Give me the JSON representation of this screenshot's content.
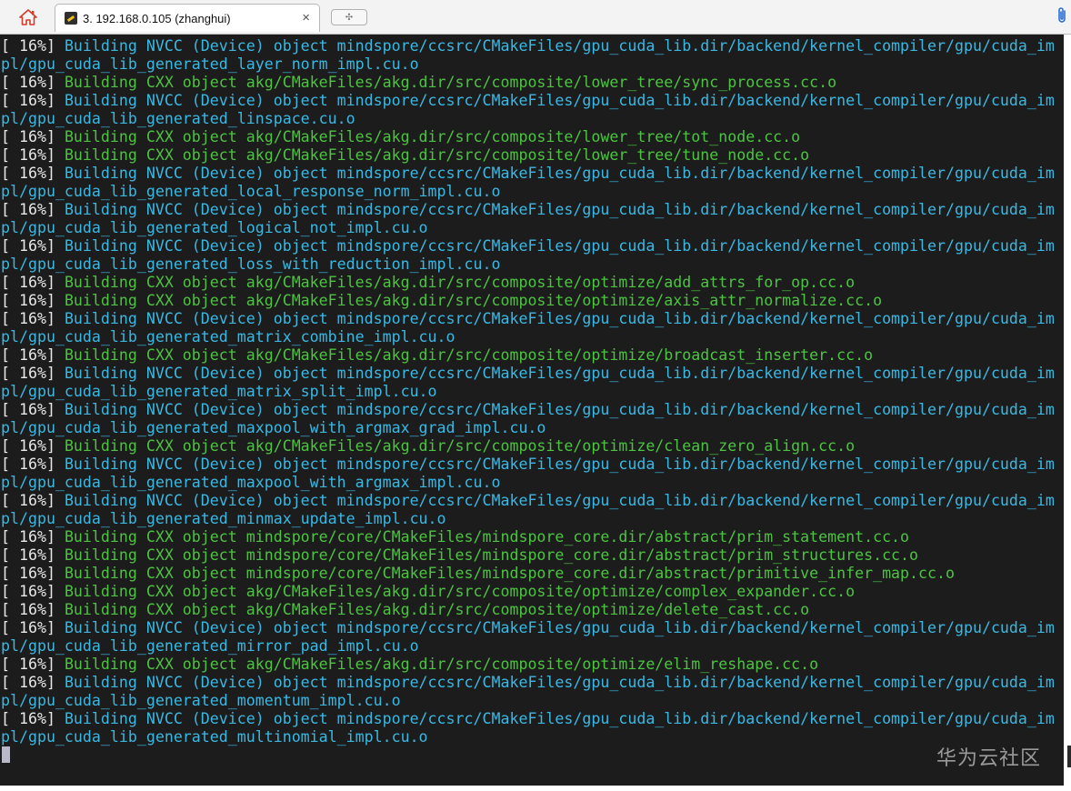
{
  "tabbar": {
    "home_icon": "home-icon",
    "tab_title": "3. 192.168.0.105 (zhanghui)",
    "tab_close": "×",
    "new_tab_glyph": "✣",
    "attach_icon": "paperclip-icon"
  },
  "terminal": {
    "lines": [
      {
        "pct": "[ 16%] ",
        "kind": "nvcc",
        "text": "Building NVCC (Device) object mindspore/ccsrc/CMakeFiles/gpu_cuda_lib.dir/backend/kernel_compiler/gpu/cuda_im"
      },
      {
        "pct": "",
        "kind": "nvcc",
        "text": "pl/gpu_cuda_lib_generated_layer_norm_impl.cu.o"
      },
      {
        "pct": "[ 16%] ",
        "kind": "cxx",
        "text": "Building CXX object akg/CMakeFiles/akg.dir/src/composite/lower_tree/sync_process.cc.o"
      },
      {
        "pct": "[ 16%] ",
        "kind": "nvcc",
        "text": "Building NVCC (Device) object mindspore/ccsrc/CMakeFiles/gpu_cuda_lib.dir/backend/kernel_compiler/gpu/cuda_im"
      },
      {
        "pct": "",
        "kind": "nvcc",
        "text": "pl/gpu_cuda_lib_generated_linspace.cu.o"
      },
      {
        "pct": "[ 16%] ",
        "kind": "cxx",
        "text": "Building CXX object akg/CMakeFiles/akg.dir/src/composite/lower_tree/tot_node.cc.o"
      },
      {
        "pct": "[ 16%] ",
        "kind": "cxx",
        "text": "Building CXX object akg/CMakeFiles/akg.dir/src/composite/lower_tree/tune_node.cc.o"
      },
      {
        "pct": "[ 16%] ",
        "kind": "nvcc",
        "text": "Building NVCC (Device) object mindspore/ccsrc/CMakeFiles/gpu_cuda_lib.dir/backend/kernel_compiler/gpu/cuda_im"
      },
      {
        "pct": "",
        "kind": "nvcc",
        "text": "pl/gpu_cuda_lib_generated_local_response_norm_impl.cu.o"
      },
      {
        "pct": "[ 16%] ",
        "kind": "nvcc",
        "text": "Building NVCC (Device) object mindspore/ccsrc/CMakeFiles/gpu_cuda_lib.dir/backend/kernel_compiler/gpu/cuda_im"
      },
      {
        "pct": "",
        "kind": "nvcc",
        "text": "pl/gpu_cuda_lib_generated_logical_not_impl.cu.o"
      },
      {
        "pct": "[ 16%] ",
        "kind": "nvcc",
        "text": "Building NVCC (Device) object mindspore/ccsrc/CMakeFiles/gpu_cuda_lib.dir/backend/kernel_compiler/gpu/cuda_im"
      },
      {
        "pct": "",
        "kind": "nvcc",
        "text": "pl/gpu_cuda_lib_generated_loss_with_reduction_impl.cu.o"
      },
      {
        "pct": "[ 16%] ",
        "kind": "cxx",
        "text": "Building CXX object akg/CMakeFiles/akg.dir/src/composite/optimize/add_attrs_for_op.cc.o"
      },
      {
        "pct": "[ 16%] ",
        "kind": "cxx",
        "text": "Building CXX object akg/CMakeFiles/akg.dir/src/composite/optimize/axis_attr_normalize.cc.o"
      },
      {
        "pct": "[ 16%] ",
        "kind": "nvcc",
        "text": "Building NVCC (Device) object mindspore/ccsrc/CMakeFiles/gpu_cuda_lib.dir/backend/kernel_compiler/gpu/cuda_im"
      },
      {
        "pct": "",
        "kind": "nvcc",
        "text": "pl/gpu_cuda_lib_generated_matrix_combine_impl.cu.o"
      },
      {
        "pct": "[ 16%] ",
        "kind": "cxx",
        "text": "Building CXX object akg/CMakeFiles/akg.dir/src/composite/optimize/broadcast_inserter.cc.o"
      },
      {
        "pct": "[ 16%] ",
        "kind": "nvcc",
        "text": "Building NVCC (Device) object mindspore/ccsrc/CMakeFiles/gpu_cuda_lib.dir/backend/kernel_compiler/gpu/cuda_im"
      },
      {
        "pct": "",
        "kind": "nvcc",
        "text": "pl/gpu_cuda_lib_generated_matrix_split_impl.cu.o"
      },
      {
        "pct": "[ 16%] ",
        "kind": "nvcc",
        "text": "Building NVCC (Device) object mindspore/ccsrc/CMakeFiles/gpu_cuda_lib.dir/backend/kernel_compiler/gpu/cuda_im"
      },
      {
        "pct": "",
        "kind": "nvcc",
        "text": "pl/gpu_cuda_lib_generated_maxpool_with_argmax_grad_impl.cu.o"
      },
      {
        "pct": "[ 16%] ",
        "kind": "cxx",
        "text": "Building CXX object akg/CMakeFiles/akg.dir/src/composite/optimize/clean_zero_align.cc.o"
      },
      {
        "pct": "[ 16%] ",
        "kind": "nvcc",
        "text": "Building NVCC (Device) object mindspore/ccsrc/CMakeFiles/gpu_cuda_lib.dir/backend/kernel_compiler/gpu/cuda_im"
      },
      {
        "pct": "",
        "kind": "nvcc",
        "text": "pl/gpu_cuda_lib_generated_maxpool_with_argmax_impl.cu.o"
      },
      {
        "pct": "[ 16%] ",
        "kind": "nvcc",
        "text": "Building NVCC (Device) object mindspore/ccsrc/CMakeFiles/gpu_cuda_lib.dir/backend/kernel_compiler/gpu/cuda_im"
      },
      {
        "pct": "",
        "kind": "nvcc",
        "text": "pl/gpu_cuda_lib_generated_minmax_update_impl.cu.o"
      },
      {
        "pct": "[ 16%] ",
        "kind": "cxx",
        "text": "Building CXX object mindspore/core/CMakeFiles/mindspore_core.dir/abstract/prim_statement.cc.o"
      },
      {
        "pct": "[ 16%] ",
        "kind": "cxx",
        "text": "Building CXX object mindspore/core/CMakeFiles/mindspore_core.dir/abstract/prim_structures.cc.o"
      },
      {
        "pct": "[ 16%] ",
        "kind": "cxx",
        "text": "Building CXX object mindspore/core/CMakeFiles/mindspore_core.dir/abstract/primitive_infer_map.cc.o"
      },
      {
        "pct": "[ 16%] ",
        "kind": "cxx",
        "text": "Building CXX object akg/CMakeFiles/akg.dir/src/composite/optimize/complex_expander.cc.o"
      },
      {
        "pct": "[ 16%] ",
        "kind": "cxx",
        "text": "Building CXX object akg/CMakeFiles/akg.dir/src/composite/optimize/delete_cast.cc.o"
      },
      {
        "pct": "[ 16%] ",
        "kind": "nvcc",
        "text": "Building NVCC (Device) object mindspore/ccsrc/CMakeFiles/gpu_cuda_lib.dir/backend/kernel_compiler/gpu/cuda_im"
      },
      {
        "pct": "",
        "kind": "nvcc",
        "text": "pl/gpu_cuda_lib_generated_mirror_pad_impl.cu.o"
      },
      {
        "pct": "[ 16%] ",
        "kind": "cxx",
        "text": "Building CXX object akg/CMakeFiles/akg.dir/src/composite/optimize/elim_reshape.cc.o"
      },
      {
        "pct": "[ 16%] ",
        "kind": "nvcc",
        "text": "Building NVCC (Device) object mindspore/ccsrc/CMakeFiles/gpu_cuda_lib.dir/backend/kernel_compiler/gpu/cuda_im"
      },
      {
        "pct": "",
        "kind": "nvcc",
        "text": "pl/gpu_cuda_lib_generated_momentum_impl.cu.o"
      },
      {
        "pct": "[ 16%] ",
        "kind": "nvcc",
        "text": "Building NVCC (Device) object mindspore/ccsrc/CMakeFiles/gpu_cuda_lib.dir/backend/kernel_compiler/gpu/cuda_im"
      },
      {
        "pct": "",
        "kind": "nvcc",
        "text": "pl/gpu_cuda_lib_generated_multinomial_impl.cu.o"
      }
    ],
    "watermark": "华为云社区"
  },
  "colors": {
    "background": "#1c1c1c",
    "nvcc": "#3bb8e2",
    "cxx": "#4ec243",
    "prefix": "#e8e8e8"
  }
}
